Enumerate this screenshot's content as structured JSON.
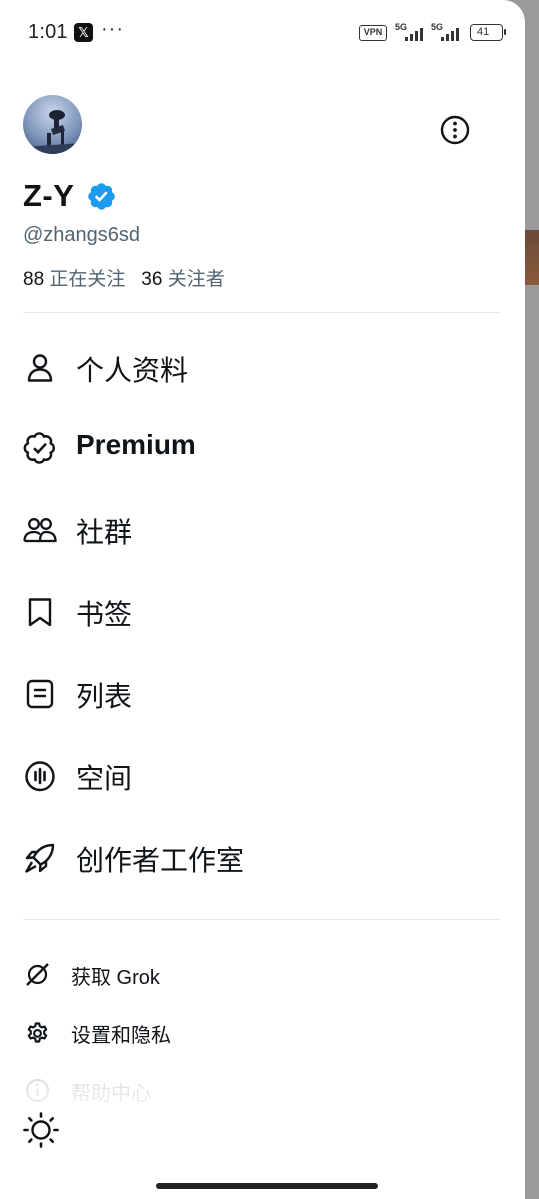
{
  "status_bar": {
    "time": "1:01",
    "app_icon_glyph": "𝕏",
    "more_dots": "···",
    "vpn": "VPN",
    "network1": "5G",
    "network2": "5G",
    "battery": "41"
  },
  "profile": {
    "display_name": "Z-Y",
    "handle": "@zhangs6sd",
    "following_count": "88",
    "following_label": "正在关注",
    "followers_count": "36",
    "followers_label": "关注者"
  },
  "menu": [
    {
      "label": "个人资料",
      "icon": "person-icon"
    },
    {
      "label": "Premium",
      "icon": "verified-badge-icon"
    },
    {
      "label": "社群",
      "icon": "communities-icon"
    },
    {
      "label": "书签",
      "icon": "bookmark-icon"
    },
    {
      "label": "列表",
      "icon": "list-icon"
    },
    {
      "label": "空间",
      "icon": "spaces-icon"
    },
    {
      "label": "创作者工作室",
      "icon": "rocket-icon"
    }
  ],
  "secondary_menu": [
    {
      "label": "获取 Grok",
      "icon": "grok-icon"
    },
    {
      "label": "设置和隐私",
      "icon": "gear-icon"
    },
    {
      "label": "帮助中心",
      "icon": "help-icon"
    }
  ],
  "colors": {
    "verified_blue": "#1d9bf0",
    "text_primary": "#0f1419",
    "text_secondary": "#536471"
  }
}
